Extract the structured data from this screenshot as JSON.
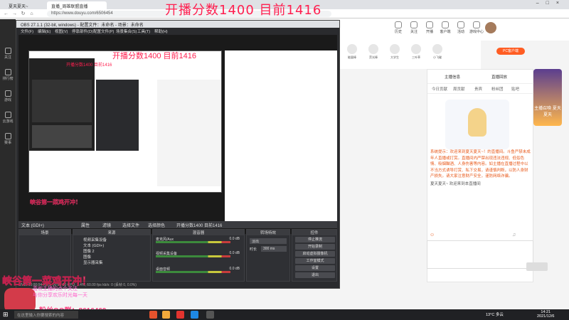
{
  "overlay_title": "开播分数1400  目前1416",
  "browser": {
    "tabs": [
      "夏天夏天~",
      "直播_周雄联盟直播"
    ],
    "url": "https://www.douyu.com/6506454"
  },
  "douyu_header": {
    "icons": [
      "历史",
      "关注",
      "开播",
      "客户端",
      "活动",
      "游戏中心"
    ]
  },
  "leftnav": [
    "关注",
    "排行榜",
    "游戏",
    "云游戏",
    "赛事"
  ],
  "gifts": [
    "能量棒",
    "荧光棒",
    "大学生",
    "三叶草",
    "小飞碟"
  ],
  "pc_client_label": "PC客户端",
  "side_panel": {
    "tabs": [
      "主播信息",
      "直播回放"
    ],
    "subtabs": [
      "今日贡献",
      "周贡献",
      "贵宾",
      "粉丝团",
      "贴吧"
    ],
    "chat_lines": [
      {
        "cls": "sys",
        "text": "系统提示：欢迎来到夏天夏天~！的直播间。斗鱼严禁未成年人直播或打赏。直播间内严禁出现违法违规、低俗色情、吸烟酗酒、人身伤害等内容。如主播在直播过程中以不当方式诱导打赏、私下交易，请谨慎判断，以防人身财产损失。请大家注意财产安全，谨防网络诈骗。"
      },
      {
        "cls": "",
        "text": "夏天夏天~ 欢迎来到本直播间"
      }
    ],
    "ad_label": "主播召唤\n夏天夏天"
  },
  "obs": {
    "title": "OBS 27.1.1 (32-bit, windows) - 配置文件：未命名 - 场景：未命名",
    "menu": [
      "文件(F)",
      "编辑(E)",
      "视图(V)",
      "停靠部件(D)",
      "配置文件(P)",
      "场景集合(S)",
      "工具(T)",
      "帮助(H)"
    ],
    "nested_title": "开播分数1400  目前1416",
    "nested2_title": "开播分数1400  目前1416",
    "preview_banner": "峡谷第一菜鸡开冲！",
    "transition_bar": [
      "文本 (GDI+)",
      "属性",
      "滤镜",
      "选择文件",
      "选择颜色",
      "开播分数1400  目前1416"
    ],
    "docks": {
      "scenes_header": "场景",
      "sources_header": "来源",
      "mixer_header": "混音器",
      "transitions_header": "转场特效",
      "controls_header": "控件",
      "sources": [
        "视频采集设备",
        "文本 (GDI+)",
        "图像 2",
        "图像",
        "显示器采集"
      ],
      "mixer": [
        {
          "name": "麦克风/Aux",
          "db": "0.0 dB"
        },
        {
          "name": "视频采集设备",
          "db": "0.0 dB"
        },
        {
          "name": "桌面音频",
          "db": "0.0 dB"
        }
      ],
      "transition": {
        "mode": "淡出",
        "duration_label": "时长",
        "duration": "300 ms"
      },
      "controls": [
        "停止推流",
        "开始录制",
        "启动虚拟摄像机",
        "工作室模式",
        "设置",
        "退出"
      ]
    },
    "status": "LIVE: 00:00:04   REC: 00:00:00   CPU: 2.4%, 60.00 fps   kb/s: 0 (丢帧 0, 0.0%)"
  },
  "streamer_overlay": {
    "banner": "峡谷第一菜鸡开冲！",
    "sub1": "喜欢主播的点个关注",
    "sub2": "与你分享欢乐时光每一天",
    "qq": "粉丝QQ群：8616469"
  },
  "taskbar": {
    "search_placeholder": "在这里输入你要搜索的内容",
    "weather": "13°C 多云",
    "time": "14:21",
    "date": "2021/12/6"
  }
}
